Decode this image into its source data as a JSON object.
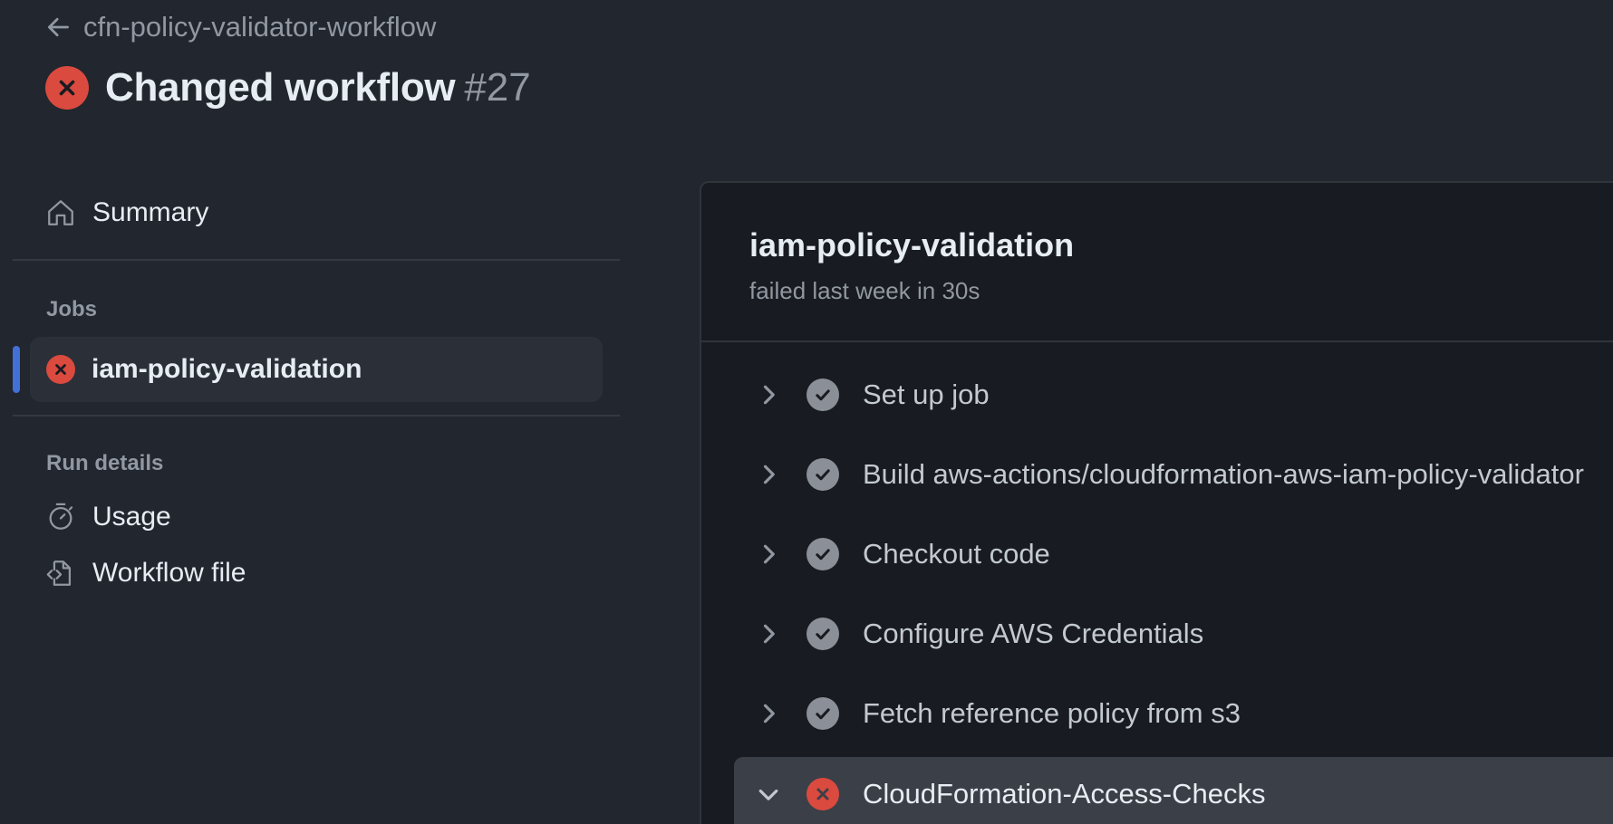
{
  "header": {
    "back_label": "cfn-policy-validator-workflow",
    "title": "Changed workflow",
    "run_number": "#27",
    "status": "failed"
  },
  "sidebar": {
    "summary_label": "Summary",
    "jobs_section": "Jobs",
    "jobs": [
      {
        "label": "iam-policy-validation",
        "status": "failed",
        "selected": true
      }
    ],
    "run_details_section": "Run details",
    "run_details": [
      {
        "label": "Usage",
        "icon": "stopwatch-icon"
      },
      {
        "label": "Workflow file",
        "icon": "file-code-icon"
      }
    ]
  },
  "job": {
    "title": "iam-policy-validation",
    "subtitle": "failed last week in 30s",
    "steps": [
      {
        "label": "Set up job",
        "status": "success",
        "expanded": false
      },
      {
        "label": "Build aws-actions/cloudformation-aws-iam-policy-validator",
        "status": "success",
        "expanded": false
      },
      {
        "label": "Checkout code",
        "status": "success",
        "expanded": false
      },
      {
        "label": "Configure AWS Credentials",
        "status": "success",
        "expanded": false
      },
      {
        "label": "Fetch reference policy from s3",
        "status": "success",
        "expanded": false
      },
      {
        "label": "CloudFormation-Access-Checks",
        "status": "failed",
        "expanded": true
      }
    ]
  },
  "colors": {
    "background": "#22262e",
    "panel": "#181b21",
    "failure": "#da4a3f",
    "success_icon": "#8b9098",
    "accent": "#4270d6"
  }
}
